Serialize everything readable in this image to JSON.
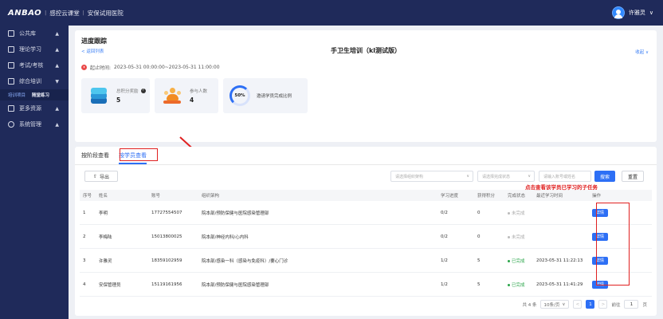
{
  "topbar": {
    "logo": "ANBAO",
    "brand": "感控云课堂",
    "hospital": "安保试用医院",
    "user": "许雅灵"
  },
  "sidebar": {
    "items": [
      {
        "label": "公共库",
        "caret": "▲"
      },
      {
        "label": "理论学习",
        "caret": "▲"
      },
      {
        "label": "考试/考核",
        "caret": "▲"
      },
      {
        "label": "综合培训",
        "caret": "▼"
      },
      {
        "label": "更多资源",
        "caret": "▲"
      },
      {
        "label": "系统管理",
        "caret": "▲"
      }
    ],
    "subitems": [
      "培训项目",
      "随堂练习"
    ]
  },
  "header": {
    "page_title": "进度跟踪",
    "back": "< 返回列表",
    "course_title": "手卫生培训（kl测试版）",
    "collapse": "收起 ∨",
    "time_label": "起止时间:",
    "time_range": "2023-05-31 00:00:00~2023-05-31 11:00:00"
  },
  "stats": {
    "points_label": "总积分奖励",
    "points_value": "5",
    "people_label": "参与人数",
    "people_value": "4",
    "percent": "50%",
    "percent_label": "邀请学员完成比例"
  },
  "tabs": [
    "按阶段查看",
    "按学员查看"
  ],
  "toolbar": {
    "export": "导出",
    "org_placeholder": "请选择组织架构",
    "status_placeholder": "请选择完成状态",
    "search_placeholder": "请输入账号或姓名",
    "search_btn": "搜索",
    "reset_btn": "重置"
  },
  "table": {
    "headers": [
      "序号",
      "姓名",
      "账号",
      "组织架构",
      "学习进度",
      "获得积分",
      "完成状态",
      "最近学习时间",
      "操作"
    ],
    "rows": [
      {
        "no": "1",
        "name": "李明",
        "account": "17727554507",
        "org": "院本部/预防保健与医院感染管理部",
        "progress": "0/2",
        "points": "0",
        "status": "未完成",
        "status_type": "pending",
        "last": "",
        "op": "详情"
      },
      {
        "no": "2",
        "name": "李梅陆",
        "account": "15013800025",
        "org": "院本部/神经内科/心内科",
        "progress": "0/2",
        "points": "0",
        "status": "未完成",
        "status_type": "pending",
        "last": "",
        "op": "详情"
      },
      {
        "no": "3",
        "name": "许雅灵",
        "account": "18359102959",
        "org": "院本部/感染一科（感染与免疫科）/要心门诊",
        "progress": "1/2",
        "points": "5",
        "status": "已完成",
        "status_type": "done",
        "last": "2023-05-31 11:22:13",
        "op": "详情"
      },
      {
        "no": "4",
        "name": "安保管理员",
        "account": "15119161956",
        "org": "院本部/预防保健与医院感染管理部",
        "progress": "1/2",
        "points": "5",
        "status": "已完成",
        "status_type": "done",
        "last": "2023-05-31 11:41:29",
        "op": "详情"
      }
    ]
  },
  "annotation": {
    "text": "点击查看该学员已学习的子任务"
  },
  "pager": {
    "total": "共 4 条",
    "size": "10条/页",
    "size_caret": "∨",
    "prev": "<",
    "page": "1",
    "next": ">",
    "goto": "前往",
    "goto_value": "1",
    "unit": "页"
  },
  "colors": {
    "primary": "#2d6ff5",
    "nav": "#1f2a5a",
    "annotation": "#e02020",
    "done": "#2aa54a"
  }
}
